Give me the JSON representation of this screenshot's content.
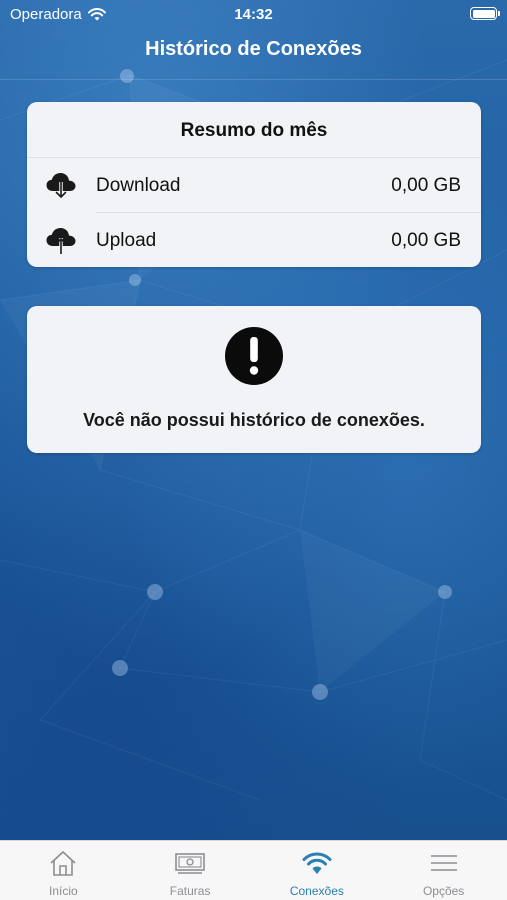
{
  "status_bar": {
    "carrier": "Operadora",
    "time": "14:32"
  },
  "header": {
    "title": "Histórico de Conexões"
  },
  "summary": {
    "title": "Resumo do mês",
    "rows": [
      {
        "label": "Download",
        "value": "0,00 GB",
        "icon": "cloud-download-icon"
      },
      {
        "label": "Upload",
        "value": "0,00 GB",
        "icon": "cloud-upload-icon"
      }
    ]
  },
  "notice": {
    "icon": "exclamation-circle-icon",
    "message": "Você não possui histórico de conexões."
  },
  "tabbar": {
    "tabs": [
      {
        "label": "Início",
        "icon": "home-icon",
        "active": false
      },
      {
        "label": "Faturas",
        "icon": "banknote-icon",
        "active": false
      },
      {
        "label": "Conexões",
        "icon": "wifi-icon",
        "active": true
      },
      {
        "label": "Opções",
        "icon": "menu-icon",
        "active": false
      }
    ]
  },
  "colors": {
    "background": "#1d5a98",
    "card": "#f1f3f7",
    "tab_active": "#2b7fb3",
    "tab_inactive": "#8e8e93"
  }
}
